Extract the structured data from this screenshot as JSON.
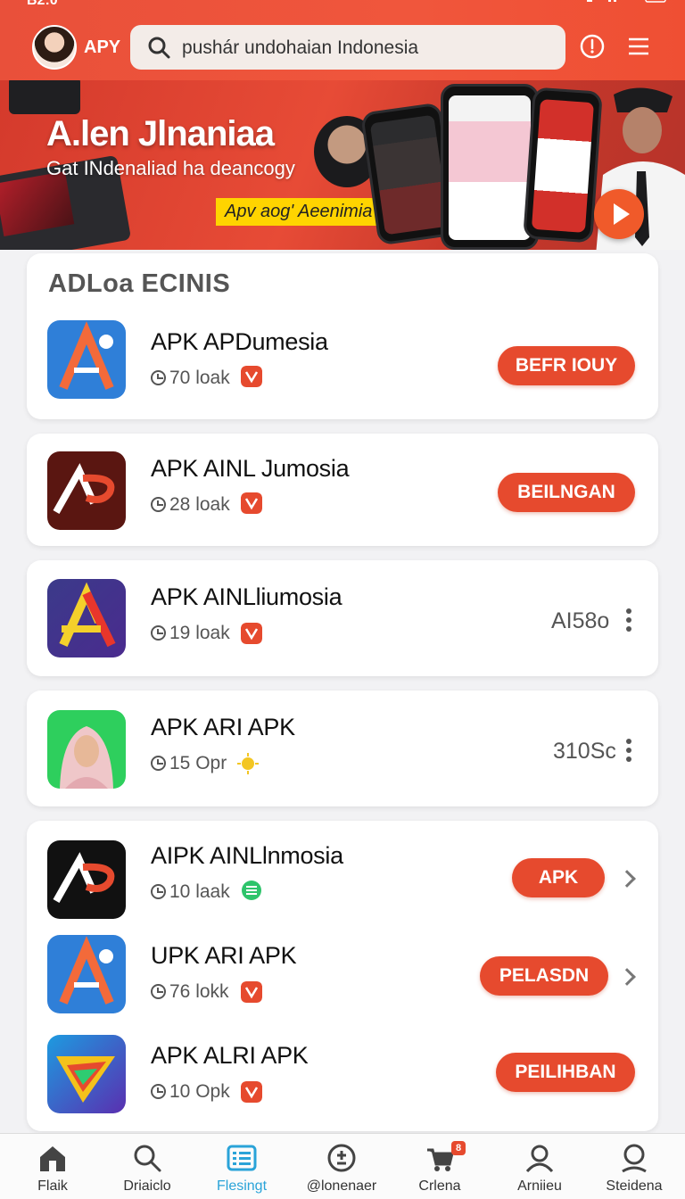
{
  "status": {
    "time": "B2:0"
  },
  "header": {
    "brand": "APY",
    "search_text": "pushár undohaian Indonesia"
  },
  "banner": {
    "title": "A.len Jlnaniaa",
    "subtitle": "Gat INdenaliad ha deancogy",
    "tag": "Apv aog' Aeenimia tenr"
  },
  "section": {
    "title": "ADLoa ECINIS"
  },
  "apps": [
    {
      "name": "APK APDumesia",
      "meta": "70 loak",
      "action": "BEFR IOUY"
    },
    {
      "name": "APK AINL Jumosia",
      "meta": "28 loak",
      "action": "BEILNGAN"
    },
    {
      "name": "APK AINLliumosia",
      "meta": "19 loak",
      "side": "AI58o"
    },
    {
      "name": "APK ARI APK",
      "meta": "15 Opr",
      "side": "310Sc"
    },
    {
      "name": "AIPK AINLlnmosia",
      "meta": "10 laak",
      "action": "APK"
    },
    {
      "name": "UPK ARI APK",
      "meta": "76 lokk",
      "action": "PELASDN"
    },
    {
      "name": "APK ALRI APK",
      "meta": "10 Opk",
      "action": "PEILIHBAN"
    }
  ],
  "nav": [
    {
      "label": "Flaik",
      "icon": "home-icon"
    },
    {
      "label": "Driaiclo",
      "icon": "search-icon"
    },
    {
      "label": "Flesingt",
      "icon": "list-icon"
    },
    {
      "label": "@lonenaer",
      "icon": "plus-minus-icon"
    },
    {
      "label": "Crlena",
      "icon": "cart-icon",
      "badge": "8"
    },
    {
      "label": "Arniieu",
      "icon": "user-icon"
    },
    {
      "label": "Steidena",
      "icon": "search-alt-icon"
    }
  ],
  "colors": {
    "accent": "#e64a2e",
    "active_nav": "#2aa3d8",
    "banner_tag": "#ffd400"
  }
}
